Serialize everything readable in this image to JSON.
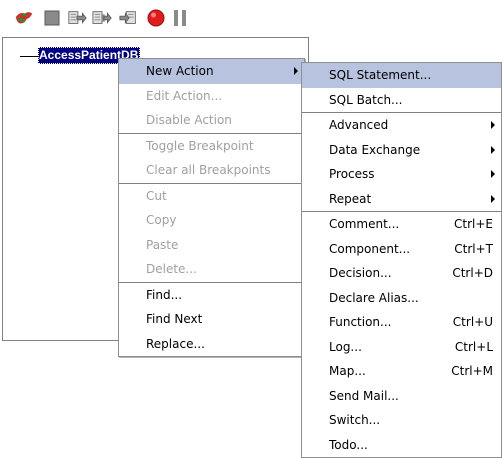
{
  "toolbar": {
    "buttons": [
      {
        "icon": "run-icon"
      },
      {
        "icon": "stop-icon"
      },
      {
        "icon": "step-into-icon"
      },
      {
        "icon": "step-over-icon"
      },
      {
        "icon": "step-out-icon"
      },
      {
        "icon": "record-icon"
      },
      {
        "icon": "pause-icon"
      }
    ]
  },
  "tree": {
    "root_label": "AccessPatientDB"
  },
  "context_menu": {
    "items": [
      {
        "label": "New Action",
        "state": "highlight",
        "submenu": true
      },
      {
        "label": "Edit Action...",
        "state": "disabled"
      },
      {
        "label": "Disable Action",
        "state": "disabled"
      },
      {
        "separator": true
      },
      {
        "label": "Toggle Breakpoint",
        "state": "disabled"
      },
      {
        "label": "Clear all Breakpoints",
        "state": "disabled"
      },
      {
        "separator": true
      },
      {
        "label": "Cut",
        "state": "disabled"
      },
      {
        "label": "Copy",
        "state": "disabled"
      },
      {
        "label": "Paste",
        "state": "disabled"
      },
      {
        "label": "Delete...",
        "state": "disabled"
      },
      {
        "separator": true
      },
      {
        "label": "Find...",
        "state": "enabled"
      },
      {
        "label": "Find Next",
        "state": "enabled"
      },
      {
        "label": "Replace...",
        "state": "enabled"
      }
    ]
  },
  "submenu": {
    "items": [
      {
        "label": "SQL Statement...",
        "state": "highlight"
      },
      {
        "label": "SQL Batch...",
        "state": "enabled"
      },
      {
        "separator": true
      },
      {
        "label": "Advanced",
        "submenu": true
      },
      {
        "label": "Data Exchange",
        "submenu": true
      },
      {
        "label": "Process",
        "submenu": true
      },
      {
        "label": "Repeat",
        "submenu": true
      },
      {
        "separator": true
      },
      {
        "label": "Comment...",
        "accel": "Ctrl+E"
      },
      {
        "label": "Component...",
        "accel": "Ctrl+T"
      },
      {
        "label": "Decision...",
        "accel": "Ctrl+D"
      },
      {
        "label": "Declare Alias..."
      },
      {
        "label": "Function...",
        "accel": "Ctrl+U"
      },
      {
        "label": "Log...",
        "accel": "Ctrl+L"
      },
      {
        "label": "Map...",
        "accel": "Ctrl+M"
      },
      {
        "label": "Send Mail..."
      },
      {
        "label": "Switch..."
      },
      {
        "label": "Todo..."
      }
    ]
  },
  "colors": {
    "selection": "#000080",
    "menu_highlight": "#b8c3df",
    "disabled_text": "#a0a0a0"
  }
}
